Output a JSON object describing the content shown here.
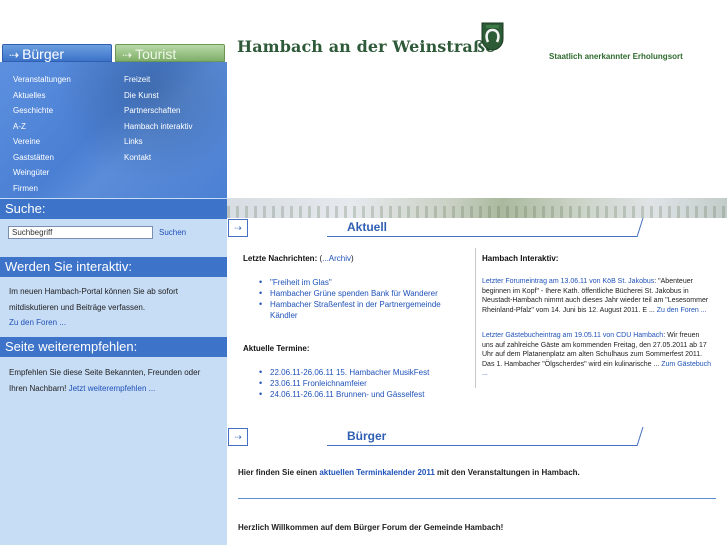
{
  "tabs": {
    "primary": "Bürger",
    "secondary": "Tourist"
  },
  "nav": {
    "left": [
      "Veranstaltungen",
      "Aktuelles",
      "Geschichte",
      "A-Z",
      "Vereine",
      "Gaststätten",
      "Weingüter",
      "Firmen"
    ],
    "right": [
      "Freizeit",
      "Die Kunst",
      "Partnerschaften",
      "Hambach interaktiv",
      "Links",
      "Kontakt"
    ]
  },
  "search": {
    "heading": "Suche:",
    "value": "Suchbegriff",
    "button": "Suchen"
  },
  "interactive": {
    "heading": "Werden Sie interaktiv:",
    "text": "Im neuen Hambach-Portal können Sie ab sofort mitdiskutieren und Beiträge verfassen.",
    "link": "Zu den Foren ..."
  },
  "recommend": {
    "heading": "Seite weiterempfehlen:",
    "text": "Empfehlen Sie diese Seite Bekannten, Freunden oder Ihren Nachbarn!",
    "link": "Jetzt weiterempfehlen ..."
  },
  "header": {
    "title": "Hambach an der Weinstraße",
    "slogan": "Staatlich anerkannter Erholungsort"
  },
  "aktuell": {
    "heading": "Aktuell",
    "news_label": "Letzte Nachrichten:",
    "archive_prefix": "(",
    "archive_link": "...Archiv",
    "archive_suffix": ")",
    "news": [
      "\"Freiheit im Glas\"",
      "Hambacher Grüne spenden Bank für Wanderer",
      "Hambacher Straßenfest in der Partnergemeinde Kändler"
    ],
    "events_label": "Aktuelle Termine:",
    "events": [
      "22.06.11-26.06.11 15. Hambacher MusikFest",
      "23.06.11 Fronleichnamfeier",
      "24.06.11-26.06.11 Brunnen- und Gässelfest"
    ],
    "interactive_label": "Hambach Interaktiv:",
    "forum": {
      "label": "Letzter Forumeintrag",
      "meta": " am 13.06.11 von KöB St. Jakobus",
      "text": ": \"Abenteuer beginnen im Kopf\" - Ihere Kath. öffentliche Bücherei St. Jakobus in Neustadt-Hambach nimmt auch dieses Jahr wieder teil am \"Lesesommer Rheinland-Pfalz\" vom 14. Juni bis 12. August 2011. E ... ",
      "link": "Zu den Foren ..."
    },
    "guestbook": {
      "label": "Letzter Gästebucheintrag",
      "meta": " am 19.05.11 von CDU Hambach",
      "text": ": Wir freuen uns auf zahlreiche Gäste am kommenden Freitag, den 27.05.2011 ab 17 Uhr auf dem Platanenplatz am alten Schulhaus zum Sommerfest 2011. Das 1. Hambacher \"Ölgscherdes\" wird ein kulinarische ... ",
      "link": "Zum Gästebuch ..."
    }
  },
  "buerger": {
    "heading": "Bürger",
    "lead_prefix": "Hier finden Sie einen ",
    "lead_link": "aktuellen Terminkalender 2011",
    "lead_suffix": " mit den Veranstaltungen in Hambach.",
    "welcome": "Herzlich Willkommen auf dem Bürger Forum der Gemeinde Hambach!"
  },
  "icons": {
    "tab_arrow": "arrow-right-icon",
    "section_arrow": "arrow-right-icon",
    "crest": "horseshoe-crest-icon"
  },
  "colors": {
    "primary_blue": "#3d73c9",
    "sidebar_bg": "#c7dcf5",
    "title_green": "#2f5a3a",
    "link_blue": "#1f52b8"
  }
}
